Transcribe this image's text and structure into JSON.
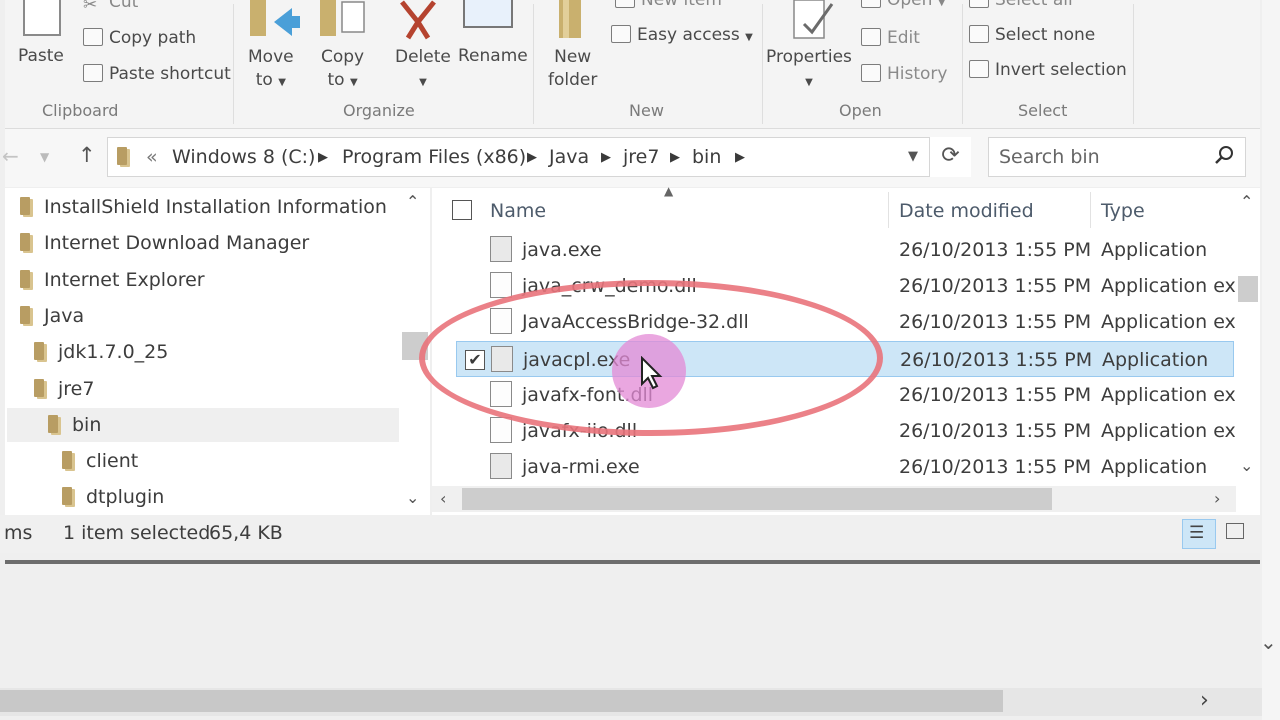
{
  "ribbon": {
    "clipboard": {
      "label": "Clipboard",
      "paste": "Paste",
      "cut": "Cut",
      "copy_path": "Copy path",
      "paste_shortcut": "Paste shortcut"
    },
    "organize": {
      "label": "Organize",
      "move_to_1": "Move",
      "move_to_2": "to",
      "copy_to_1": "Copy",
      "copy_to_2": "to",
      "delete": "Delete",
      "rename": "Rename"
    },
    "new": {
      "label": "New",
      "new_item": "New item",
      "easy_access": "Easy access",
      "new_folder_1": "New",
      "new_folder_2": "folder"
    },
    "open": {
      "label": "Open",
      "open": "Open",
      "edit": "Edit",
      "history": "History",
      "properties": "Properties"
    },
    "select": {
      "label": "Select",
      "select_all": "Select all",
      "select_none": "Select none",
      "invert_selection": "Invert selection"
    }
  },
  "address": {
    "chevron": "«",
    "path": [
      "Windows 8 (C:)",
      "Program Files (x86)",
      "Java",
      "jre7",
      "bin"
    ],
    "search_placeholder": "Search bin"
  },
  "nav_tree": [
    {
      "label": "InstallShield Installation Information",
      "indent": 0
    },
    {
      "label": "Internet Download Manager",
      "indent": 0
    },
    {
      "label": "Internet Explorer",
      "indent": 0
    },
    {
      "label": "Java",
      "indent": 0
    },
    {
      "label": "jdk1.7.0_25",
      "indent": 1
    },
    {
      "label": "jre7",
      "indent": 1
    },
    {
      "label": "bin",
      "indent": 2,
      "selected": true
    },
    {
      "label": "client",
      "indent": 3
    },
    {
      "label": "dtplugin",
      "indent": 3
    }
  ],
  "file_list": {
    "columns": {
      "name": "Name",
      "date": "Date modified",
      "type": "Type"
    },
    "rows": [
      {
        "name": "java.exe",
        "date": "26/10/2013 1:55 PM",
        "type": "Application"
      },
      {
        "name": "java_crw_demo.dll",
        "date": "26/10/2013 1:55 PM",
        "type": "Application ext"
      },
      {
        "name": "JavaAccessBridge-32.dll",
        "date": "26/10/2013 1:55 PM",
        "type": "Application ext"
      },
      {
        "name": "javacpl.exe",
        "date": "26/10/2013 1:55 PM",
        "type": "Application",
        "selected": true
      },
      {
        "name": "javafx-font.dll",
        "date": "26/10/2013 1:55 PM",
        "type": "Application ext"
      },
      {
        "name": "javafx-iio.dll",
        "date": "26/10/2013 1:55 PM",
        "type": "Application ext"
      },
      {
        "name": "java-rmi.exe",
        "date": "26/10/2013 1:55 PM",
        "type": "Application"
      }
    ]
  },
  "status": {
    "items_partial": "ms",
    "selected": "1 item selected",
    "size": "65,4 KB"
  },
  "colors": {
    "selection_bg": "#cde6f7",
    "annotation_ring": "#e9737b",
    "cursor_highlight": "#e389d6"
  }
}
